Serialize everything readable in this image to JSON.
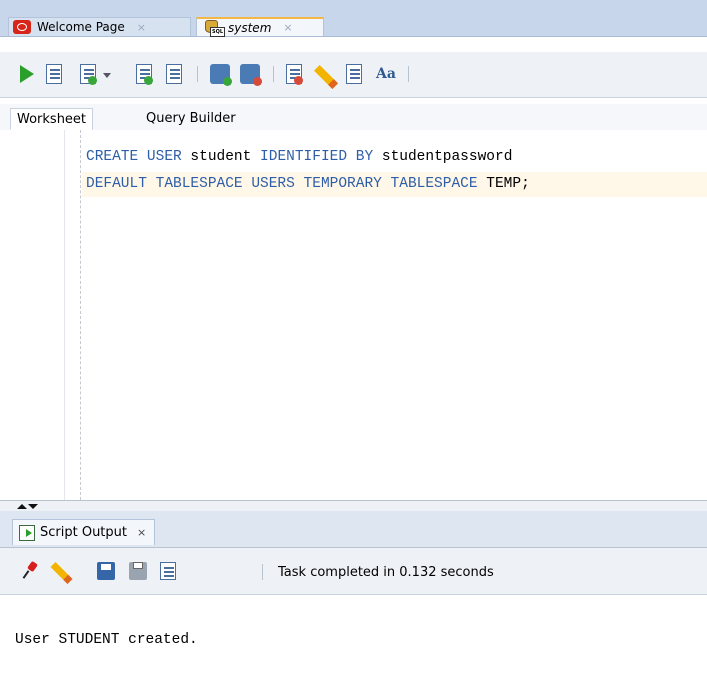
{
  "tabs": [
    {
      "label": "Welcome Page",
      "close": "×",
      "icon": "oracle-logo-icon"
    },
    {
      "label": "system",
      "close": "×",
      "icon": "database-sql-icon"
    }
  ],
  "subtabs": {
    "worksheet": "Worksheet",
    "query_builder": "Query Builder"
  },
  "editor": {
    "line1": {
      "kw1": "CREATE USER",
      "id1": " student ",
      "kw2": "IDENTIFIED BY",
      "id2": " studentpassword"
    },
    "line2": {
      "kw1": "DEFAULT TABLESPACE USERS TEMPORARY TABLESPACE",
      "id1": " TEMP;"
    }
  },
  "toolbar_icons": [
    "run-statement-icon",
    "run-script-icon",
    "autotrace-icon",
    "explain-plan-icon",
    "sql-tuning-icon",
    "commit-icon",
    "rollback-icon",
    "sql-history-icon",
    "clear-icon",
    "sql-worksheet-history-icon",
    "format-case-icon"
  ],
  "output": {
    "tab_label": "Script Output",
    "tab_close": "×",
    "status": "Task completed in 0.132 seconds",
    "text": "User STUDENT created."
  },
  "colors": {
    "keyword": "#2f5ea8",
    "highlight_line": "#fff8e8",
    "tab_accent": "#f3b744"
  }
}
